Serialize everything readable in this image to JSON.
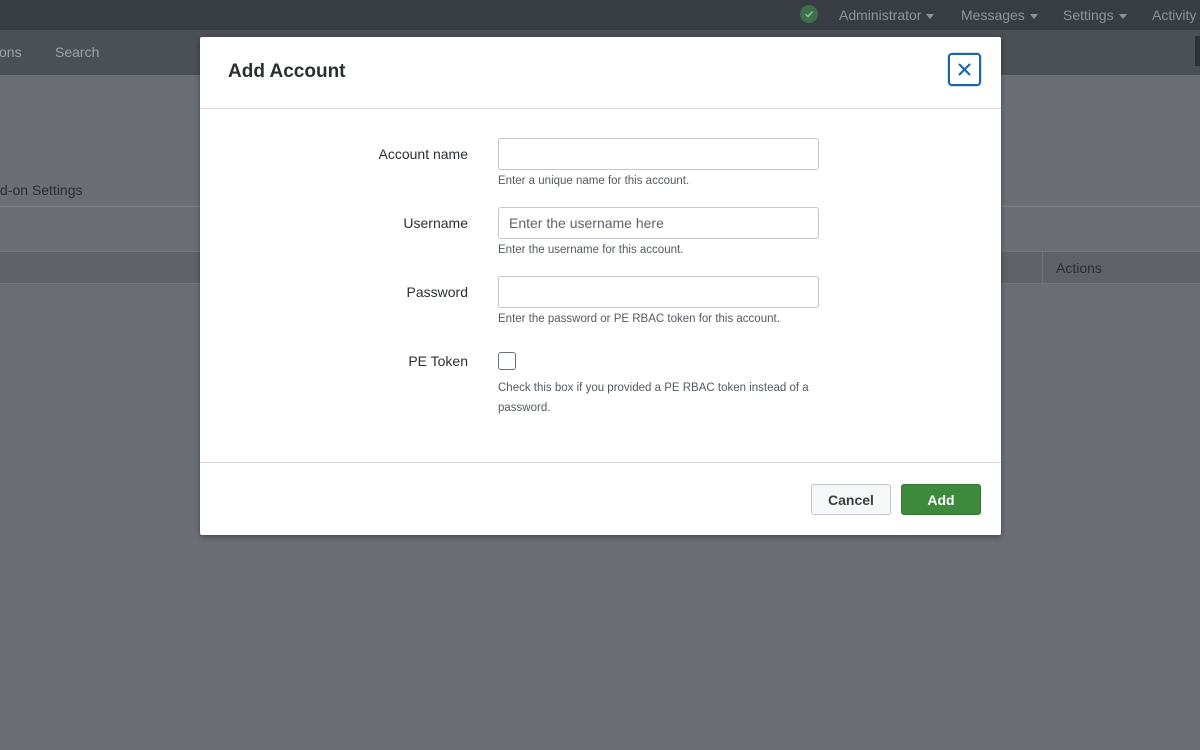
{
  "topbar": {
    "menus": [
      {
        "label": "Administrator"
      },
      {
        "label": "Messages"
      },
      {
        "label": "Settings"
      },
      {
        "label": "Activity"
      }
    ]
  },
  "appbar": {
    "nav": [
      {
        "label": "ons"
      },
      {
        "label": "Search"
      }
    ]
  },
  "page": {
    "heading": "d-on Settings",
    "table": {
      "actions_header": "Actions"
    }
  },
  "modal": {
    "title": "Add Account",
    "fields": {
      "account_name": {
        "label": "Account name",
        "value": "",
        "placeholder": "",
        "help": "Enter a unique name for this account."
      },
      "username": {
        "label": "Username",
        "value": "",
        "placeholder": "Enter the username here",
        "help": "Enter the username for this account."
      },
      "password": {
        "label": "Password",
        "value": "",
        "placeholder": "",
        "help": "Enter the password or PE RBAC token for this account."
      },
      "pe_token": {
        "label": "PE Token",
        "checked": false,
        "help_line1": "Check this box if you provided a PE RBAC token instead of a",
        "help_line2": "password."
      }
    },
    "buttons": {
      "cancel": "Cancel",
      "add": "Add"
    }
  },
  "colors": {
    "primary_button": "#3e8a3c",
    "focus_ring": "#1a64a8",
    "overlay": "#6b6e74"
  },
  "icons": {
    "status": "check-circle-icon",
    "close": "close-icon",
    "dropdown": "caret-down-icon"
  }
}
